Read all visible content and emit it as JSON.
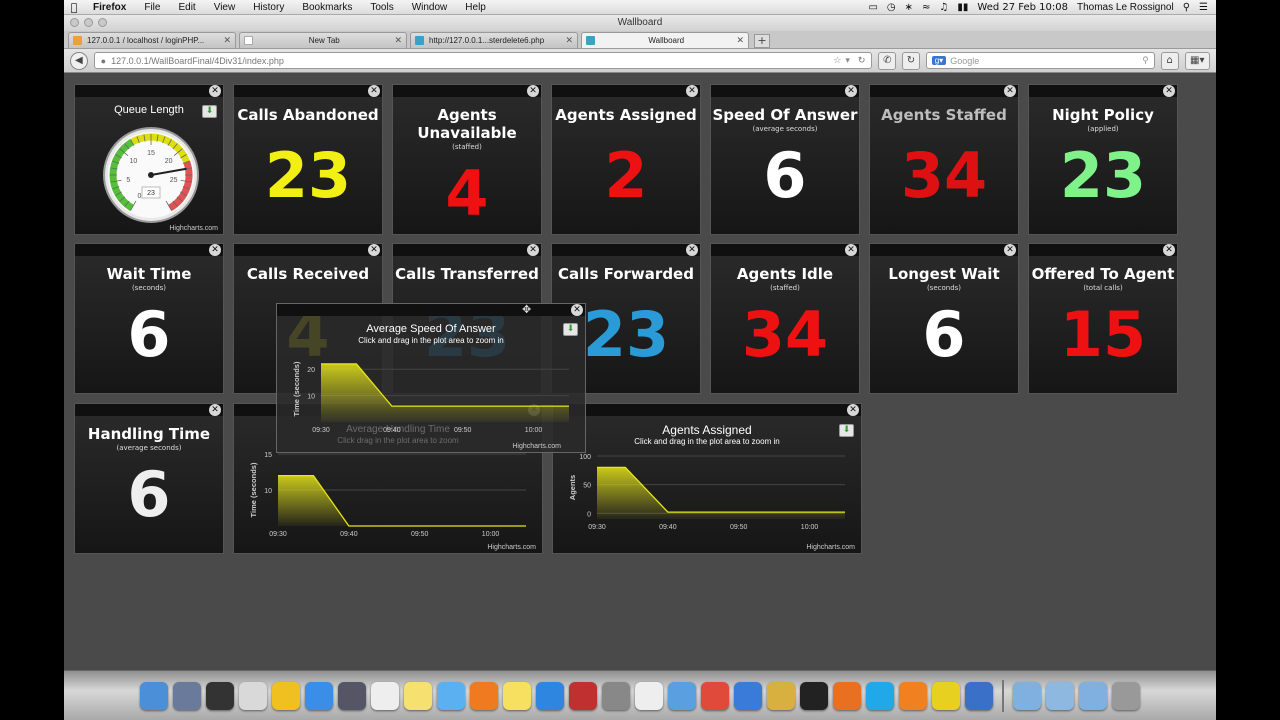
{
  "menubar": {
    "app": "Firefox",
    "items": [
      "File",
      "Edit",
      "View",
      "History",
      "Bookmarks",
      "Tools",
      "Window",
      "Help"
    ],
    "datetime": "Wed 27 Feb  10:08",
    "user": "Thomas Le Rossignol"
  },
  "window": {
    "title": "Wallboard"
  },
  "tabs": [
    {
      "label": "127.0.0.1 / localhost / loginPHP...",
      "active": false
    },
    {
      "label": "New Tab",
      "active": false
    },
    {
      "label": "http://127.0.0.1...sterdelete6.php",
      "active": false
    },
    {
      "label": "Wallboard",
      "active": true
    }
  ],
  "nav": {
    "url": "127.0.0.1/WallBoardFinal/4Div31/index.php",
    "search_placeholder": "Google"
  },
  "tiles_row1": [
    {
      "title": "Calls Abandoned",
      "subtitle": "",
      "value": "23",
      "color": "#f2ef14"
    },
    {
      "title": "Agents Unavailable",
      "subtitle": "(staffed)",
      "value": "4",
      "color": "#ee1111"
    },
    {
      "title": "Agents Assigned",
      "subtitle": "",
      "value": "2",
      "color": "#ee1111"
    },
    {
      "title": "Speed Of Answer",
      "subtitle": "(average seconds)",
      "value": "6",
      "color": "#ffffff"
    },
    {
      "title": "Agents Staffed",
      "subtitle": "",
      "value": "34",
      "color": "#dd1111"
    },
    {
      "title": "Night Policy",
      "subtitle": "(applied)",
      "value": "23",
      "color": "#7ff28a"
    }
  ],
  "tiles_row2": [
    {
      "title": "Wait Time",
      "subtitle": "(seconds)",
      "value": "6",
      "color": "#ffffff"
    },
    {
      "title": "Calls Received",
      "subtitle": "",
      "value": "4",
      "color": "#f2ef14"
    },
    {
      "title": "Calls Transferred",
      "subtitle": "",
      "value": "23",
      "color": "#2b9bd8"
    },
    {
      "title": "Calls Forwarded",
      "subtitle": "",
      "value": "23",
      "color": "#2b9bd8"
    },
    {
      "title": "Agents Idle",
      "subtitle": "(staffed)",
      "value": "34",
      "color": "#ee1111"
    },
    {
      "title": "Longest Wait",
      "subtitle": "(seconds)",
      "value": "6",
      "color": "#ffffff"
    },
    {
      "title": "Offered To Agent",
      "subtitle": "(total calls)",
      "value": "15",
      "color": "#ee1111"
    }
  ],
  "tile_handling": {
    "title": "Handling Time",
    "subtitle": "(average seconds)",
    "value": "6",
    "color": "#eeeeee"
  },
  "queue_gauge": {
    "title": "Queue Length",
    "value": "23",
    "ticks": [
      "0",
      "5",
      "10",
      "15",
      "20",
      "25"
    ],
    "credits": "Highcharts.com"
  },
  "chart_data": [
    {
      "type": "area",
      "title": "Average Handling Time",
      "subtitle": "Click and drag in the plot area to zoom in",
      "ylabel": "Time (seconds)",
      "xlabel": "",
      "x_ticks": [
        "09:30",
        "09:40",
        "09:50",
        "10:00"
      ],
      "y_ticks": [
        "10",
        "15"
      ],
      "ylim": [
        5,
        15
      ],
      "x": [
        "09:30",
        "09:35",
        "09:40",
        "09:50",
        "10:00",
        "10:05"
      ],
      "series": [
        {
          "values": [
            12,
            12,
            5,
            5,
            5,
            5
          ],
          "color": "#e6e61a"
        }
      ],
      "credits": "Highcharts.com"
    },
    {
      "type": "area",
      "title": "Agents Assigned",
      "subtitle": "Click and drag in the plot area to zoom in",
      "ylabel": "Agents",
      "xlabel": "",
      "x_ticks": [
        "09:30",
        "09:40",
        "09:50",
        "10:00"
      ],
      "y_ticks": [
        "0",
        "50",
        "100"
      ],
      "ylim": [
        -10,
        100
      ],
      "x": [
        "09:30",
        "09:34",
        "09:40",
        "09:50",
        "10:00",
        "10:05"
      ],
      "series": [
        {
          "values": [
            80,
            80,
            2,
            2,
            2,
            2
          ],
          "color": "#e6e61a"
        }
      ],
      "credits": "Highcharts.com"
    },
    {
      "type": "area",
      "title": "Average Speed Of Answer",
      "subtitle": "Click and drag in the plot area to zoom in",
      "ylabel": "Time (seconds)",
      "xlabel": "",
      "x_ticks": [
        "09:30",
        "09:40",
        "09:50",
        "10:00"
      ],
      "y_ticks": [
        "10",
        "20"
      ],
      "ylim": [
        0,
        25
      ],
      "x": [
        "09:30",
        "09:35",
        "09:40",
        "09:50",
        "10:00",
        "10:05"
      ],
      "series": [
        {
          "values": [
            22,
            22,
            6,
            6,
            6,
            6
          ],
          "color": "#e6e61a"
        }
      ],
      "credits": "Highcharts.com"
    }
  ],
  "overlay_ghost": {
    "title": "Average Handling Time",
    "subtitle": "Click drag in the plot area to zoom"
  },
  "dock": [
    "Finder",
    "Launchpad",
    "Dashboard",
    "Calendar",
    "Adium",
    "Safari",
    "FaceTime",
    "Reminders",
    "Notes",
    "iTunes",
    "XAMPP",
    "Stickies",
    "App Store",
    "Photo Booth",
    "System Preferences",
    "Preview",
    "Mail",
    "Chrome",
    "Xcode",
    "Transmit",
    "Terminal",
    "Firefox",
    "Skype",
    "VLC",
    "Cyberduck",
    "QuickTime",
    "Applications",
    "Documents",
    "Downloads",
    "Trash"
  ]
}
